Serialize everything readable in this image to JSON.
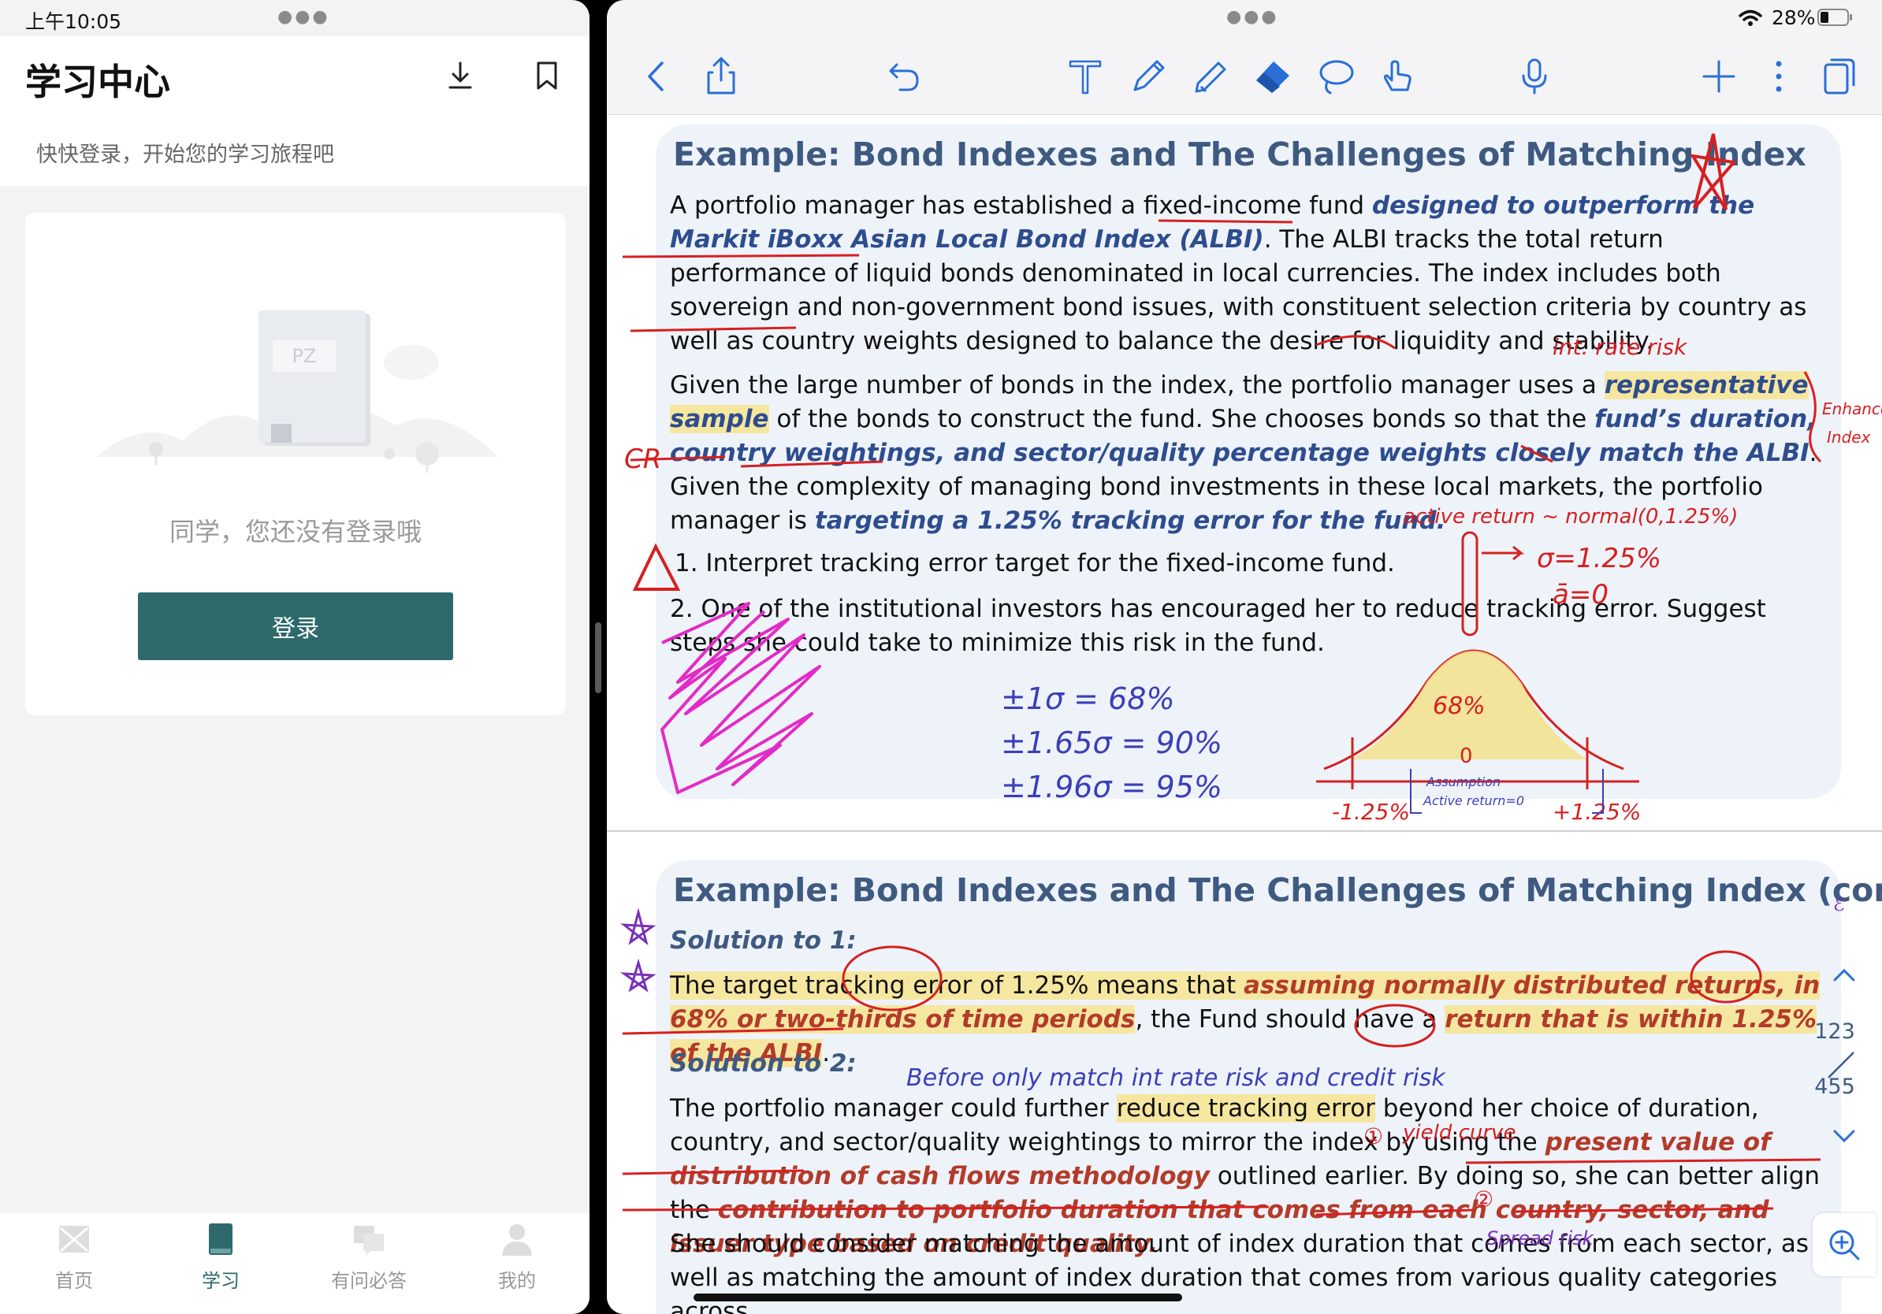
{
  "left": {
    "status_time": "上午10:05",
    "title": "学习中心",
    "subtitle": "快快登录，开始您的学习旅程吧",
    "illustration_text": "PZ",
    "empty_message": "同学，您还没有登录哦",
    "login_label": "登录",
    "tabs": [
      {
        "label": "首页",
        "icon": "envelope-icon"
      },
      {
        "label": "学习",
        "icon": "book-icon"
      },
      {
        "label": "有问必答",
        "icon": "chat-icon"
      },
      {
        "label": "我的",
        "icon": "person-icon"
      }
    ],
    "active_tab": "学习",
    "accent": "#2e6a6c"
  },
  "right": {
    "battery_pct": "28%",
    "page_numbers": {
      "top": "123",
      "bottom": "455"
    },
    "slide1": {
      "title": "Example: Bond Indexes and The Challenges of Matching Index",
      "p1_a": "A portfolio manager has established a fixed-income fund ",
      "p1_b": "designed to outperform the Markit iBoxx Asian Local Bond Index (ALBI)",
      "p1_c": ". The ALBI tracks the total return performance of liquid bonds denominated in local currencies. The index includes both sovereign and non-government bond issues, with constituent selection criteria by country as well as country weights designed to balance the desire for liquidity and stability.",
      "p2_a": "Given the large number of bonds in the index, the portfolio manager uses a ",
      "p2_b": "representative sample",
      "p2_c": " of the bonds to construct the fund. She chooses bonds so that the ",
      "p2_d": "fund’s duration, country weightings, and sector/quality percentage weights closely match the ALBI",
      "p2_e": ". Given the complexity of managing bond investments in these local markets, the portfolio manager is ",
      "p2_f": "targeting a 1.25% tracking error for the fund.",
      "q1": "1. Interpret tracking error target for the fixed-income fund.",
      "q2": "2. One of the institutional investors has encouraged her to reduce tracking error. Suggest steps she could take to minimize this risk in the fund."
    },
    "slide2": {
      "title": "Example: Bond Indexes and The Challenges of Matching Index (cont.)",
      "sol1_head": "Solution to 1:",
      "s1_a": "The target tracking error of 1.25% means that ",
      "s1_b": "assuming normally distributed returns, in 68% or two-thirds of time periods",
      "s1_c": ", the Fund should have a ",
      "s1_d": "return that is within 1.25% of the ALBI",
      "s1_e": ".",
      "sol2_head": "Solution to 2:",
      "s2_a": "The portfolio manager could further ",
      "s2_b": "reduce tracking error",
      "s2_c": " beyond her choice of duration, country, and sector/quality weightings to mirror the index by using the ",
      "s2_d": "present value of distribution of cash flows methodology",
      "s2_e": " outlined earlier. By doing so, she can better align the ",
      "s2_f": "contribution to portfolio duration that comes from each country, sector, and issuer type based on credit quality.",
      "s2_g": "She should consider matching the amount of index duration that comes from each sector, as well as matching the amount of index duration that comes from various quality categories across"
    }
  }
}
